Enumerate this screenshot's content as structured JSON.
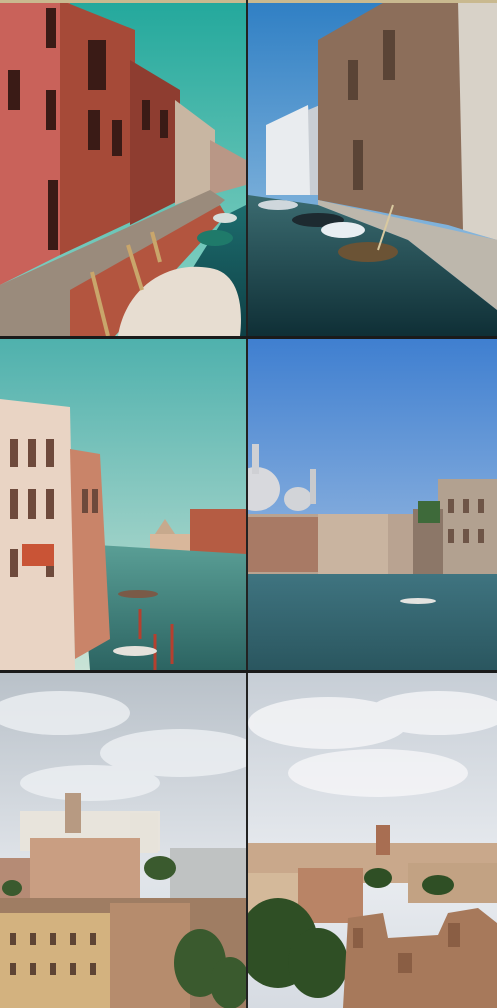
{
  "collage": {
    "rows": 3,
    "columns": 2,
    "tiles": [
      {
        "scene": "venice-side-canal-sidewalk",
        "grade": "warm-teal",
        "sky": "#2fa9a0"
      },
      {
        "scene": "venice-canal-boats-building",
        "grade": "natural-blue",
        "sky": "#2f86c8"
      },
      {
        "scene": "grand-canal-palazzi",
        "grade": "warm-teal",
        "sky": "#5fb9b6"
      },
      {
        "scene": "grand-canal-salute-dome",
        "grade": "natural-blue",
        "sky": "#4c8ad6"
      },
      {
        "scene": "rome-rooftops-vittoriano",
        "grade": "warm",
        "sky": "#cfd7df"
      },
      {
        "scene": "rome-ruins-rooftops",
        "grade": "natural",
        "sky": "#d6dbe2"
      }
    ]
  }
}
